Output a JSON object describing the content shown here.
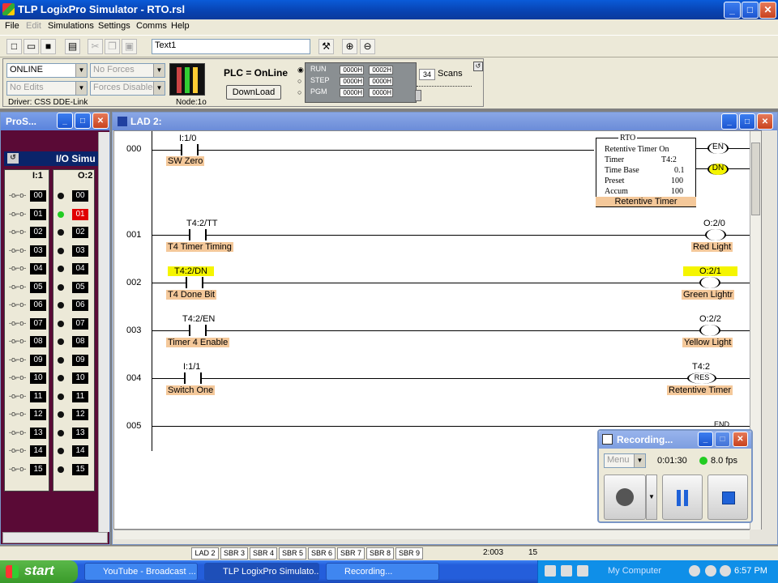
{
  "window": {
    "title": "TLP LogixPro Simulator  -  RTO.rsl",
    "min": "_",
    "max": "□",
    "close": "✕"
  },
  "menu": [
    "File",
    "Edit",
    "Simulations",
    "Settings",
    "Comms",
    "Help"
  ],
  "toolbar": {
    "text_field": "Text1"
  },
  "plc_panel": {
    "mode": "ONLINE",
    "forces": "No Forces",
    "edits": "No Edits",
    "forces_state": "Forces Disabled",
    "driver": "Driver: CSS DDE-Link",
    "node": "Node:1o",
    "status": "PLC = OnLine",
    "download": "DownLoad",
    "run": "RUN",
    "step": "STEP",
    "pgm": "PGM",
    "hex": [
      "0000H",
      "0002H",
      "0000H",
      "0000H",
      "0000H",
      "0000H"
    ],
    "scans_value": "34",
    "scans_label": "Scans"
  },
  "pro_window": {
    "title": "ProS...",
    "io_title": "I/O Simu",
    "input_header": "I:1",
    "output_header": "O:2",
    "inputs": [
      "00",
      "01",
      "02",
      "03",
      "04",
      "05",
      "06",
      "07",
      "08",
      "09",
      "10",
      "11",
      "12",
      "13",
      "14",
      "15"
    ],
    "outputs": [
      "00",
      "01",
      "02",
      "03",
      "04",
      "05",
      "06",
      "07",
      "08",
      "09",
      "10",
      "11",
      "12",
      "13",
      "14",
      "15"
    ],
    "active_input": "01",
    "active_output": "01"
  },
  "lad_window": {
    "title": "LAD 2:"
  },
  "rungs": [
    {
      "num": "000",
      "contact_addr": "I:1/0",
      "contact_tag": "SW Zero",
      "rto": {
        "title": "RTO",
        "name": "Retentive Timer On",
        "timer_label": "Timer",
        "timer": "T4:2",
        "base_label": "Time Base",
        "base": "0.1",
        "preset_label": "Preset",
        "preset": "100",
        "accum_label": "Accum",
        "accum": "100",
        "tag": "Retentive Timer",
        "en": "EN",
        "dn": "DN"
      }
    },
    {
      "num": "001",
      "contact_addr": "T4:2/TT",
      "contact_tag": "T4 Timer Timing",
      "coil_addr": "O:2/0",
      "coil_tag": "Red Light"
    },
    {
      "num": "002",
      "contact_addr": "T4:2/DN",
      "contact_tag": "T4 Done Bit",
      "coil_addr": "O:2/1",
      "coil_tag": "Green Lightr"
    },
    {
      "num": "003",
      "contact_addr": "T4:2/EN",
      "contact_tag": "Timer 4 Enable",
      "coil_addr": "O:2/2",
      "coil_tag": "Yellow Light"
    },
    {
      "num": "004",
      "contact_addr": "I:1/1",
      "contact_tag": "Switch One",
      "coil_addr": "T4:2",
      "coil_tag": "Retentive Timer",
      "coil_text": "RES"
    },
    {
      "num": "005",
      "end": "END"
    }
  ],
  "recording": {
    "title": "Recording...",
    "menu": "Menu",
    "time": "0:01:30",
    "fps": "8.0 fps"
  },
  "statusbar": {
    "sheets": [
      "LAD 2",
      "SBR 3",
      "SBR 4",
      "SBR 5",
      "SBR 6",
      "SBR 7",
      "SBR 8",
      "SBR 9"
    ],
    "pos": "2:003",
    "val": "15"
  },
  "taskbar": {
    "start": "start",
    "tasks": [
      "YouTube - Broadcast ...",
      "TLP LogixPro Simulato...",
      "Recording..."
    ],
    "mycomputer": "My Computer",
    "clock": "6:57 PM"
  },
  "colors": {
    "tag_bg": "#f4c89a",
    "highlight": "#f5f500",
    "output_on": "#e00000",
    "title_blue": "#0a5bd8"
  }
}
